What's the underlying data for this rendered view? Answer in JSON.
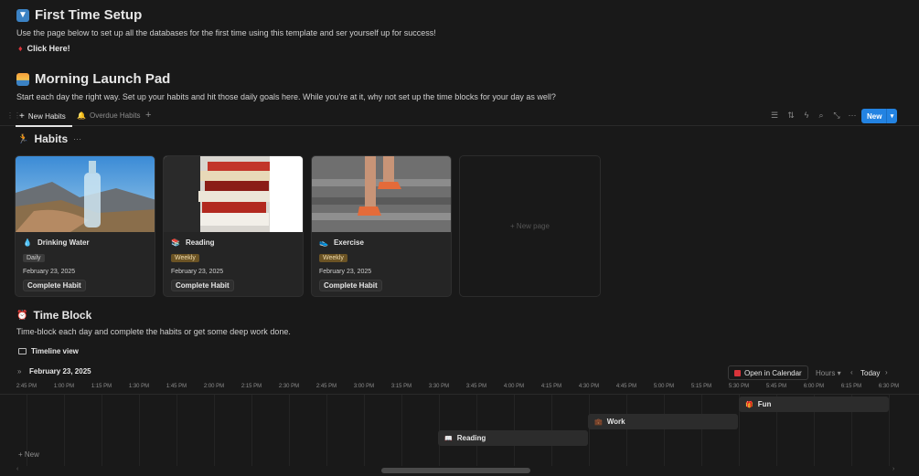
{
  "setup": {
    "title": "First Time Setup",
    "description": "Use the page below to set up all the databases for the first time using this template and ser yourself up for success!",
    "link": "Click Here!"
  },
  "launchpad": {
    "title": "Morning Launch Pad",
    "description": "Start each day the right way. Set up your habits and hit those daily goals here. While you're at it, why not set up the time blocks for your day as well?"
  },
  "tabs": {
    "active": "New Habits",
    "inactive": "Overdue Habits",
    "add": "+",
    "new_button": "New"
  },
  "toolbar_icons": [
    "filter-icon",
    "sort-icon",
    "automation-icon",
    "search-icon",
    "expand-icon",
    "more-icon"
  ],
  "habits": {
    "title": "Habits",
    "more": "···",
    "cards": [
      {
        "name": "Drinking Water",
        "tag": "Daily",
        "tag_style": "daily",
        "date": "February 23, 2025",
        "button": "Complete Habit",
        "icon": "💧"
      },
      {
        "name": "Reading",
        "tag": "Weekly",
        "tag_style": "weekly",
        "date": "February 23, 2025",
        "button": "Complete Habit",
        "icon": "📚"
      },
      {
        "name": "Exercise",
        "tag": "Weekly",
        "tag_style": "weekly",
        "date": "February 23, 2025",
        "button": "Complete Habit",
        "icon": "👟"
      }
    ],
    "new_page": "+ New page"
  },
  "timeblock": {
    "title": "Time Block",
    "description": "Time-block each day and complete the habits or get some deep work done.",
    "view": "Timeline view"
  },
  "timeline": {
    "date": "February 23, 2025",
    "open_calendar": "Open in Calendar",
    "scale": "Hours",
    "today": "Today",
    "times": [
      "2:45 PM",
      "1:00 PM",
      "1:15 PM",
      "1:30 PM",
      "1:45 PM",
      "2:00 PM",
      "2:15 PM",
      "2:30 PM",
      "2:45 PM",
      "3:00 PM",
      "3:15 PM",
      "3:30 PM",
      "3:45 PM",
      "4:00 PM",
      "4:15 PM",
      "4:30 PM",
      "4:45 PM",
      "5:00 PM",
      "5:15 PM",
      "5:30 PM",
      "5:45 PM",
      "6:00 PM",
      "6:15 PM",
      "6:30 PM"
    ],
    "events": {
      "fun": "Fun",
      "work": "Work",
      "reading": "Reading"
    },
    "new_label": "+ New"
  }
}
